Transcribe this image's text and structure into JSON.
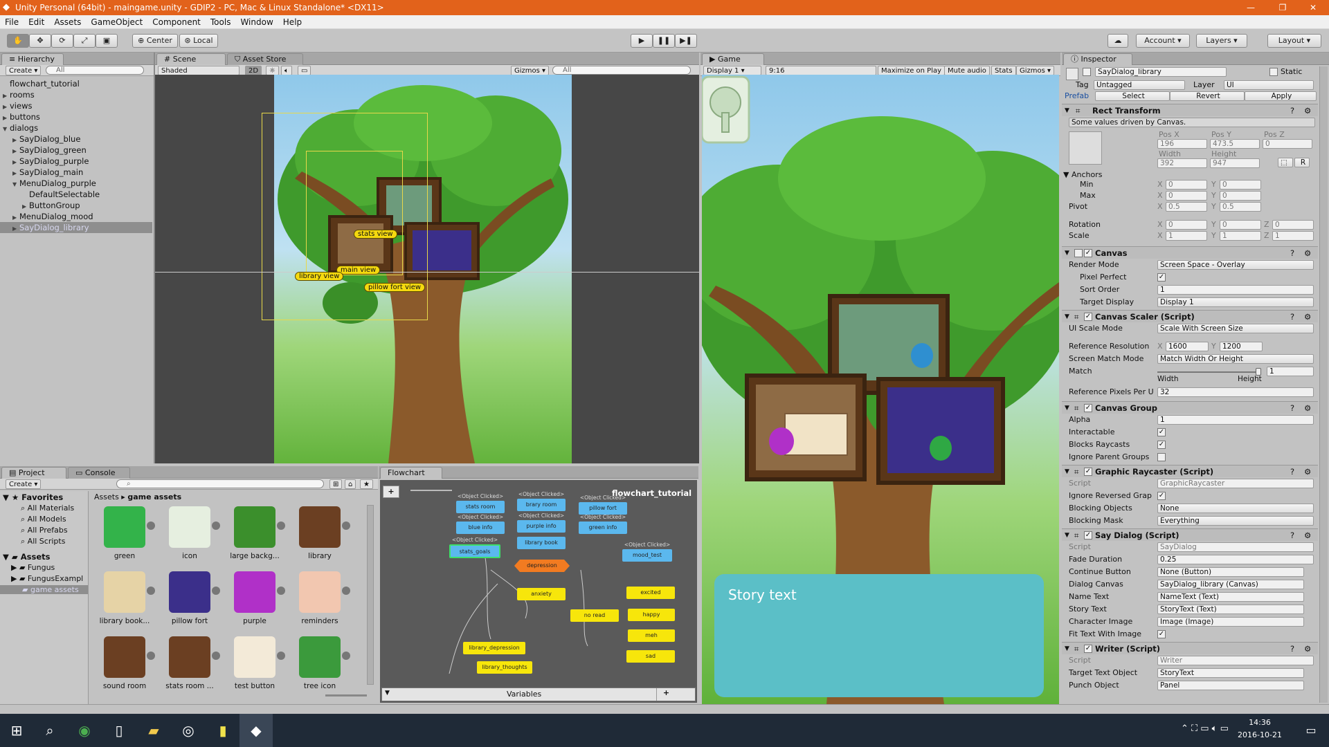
{
  "window": {
    "title": "Unity Personal (64bit) - maingame.unity - GDIP2 - PC, Mac & Linux Standalone* <DX11>",
    "min": "—",
    "max": "❐",
    "close": "✕"
  },
  "menu": [
    "File",
    "Edit",
    "Assets",
    "GameObject",
    "Component",
    "Tools",
    "Window",
    "Help"
  ],
  "toolbar": {
    "center": "Center",
    "local": "Local",
    "account": "Account",
    "layers": "Layers",
    "layout": "Layout"
  },
  "hierarchy": {
    "tab": "Hierarchy",
    "create": "Create",
    "search": "All",
    "items": [
      {
        "label": "flowchart_tutorial",
        "indent": 0,
        "arrow": ""
      },
      {
        "label": "rooms",
        "indent": 0,
        "arrow": "▶"
      },
      {
        "label": "views",
        "indent": 0,
        "arrow": "▶"
      },
      {
        "label": "buttons",
        "indent": 0,
        "arrow": "▶"
      },
      {
        "label": "dialogs",
        "indent": 0,
        "arrow": "▼"
      },
      {
        "label": "SayDialog_blue",
        "indent": 1,
        "arrow": "▶"
      },
      {
        "label": "SayDialog_green",
        "indent": 1,
        "arrow": "▶"
      },
      {
        "label": "SayDialog_purple",
        "indent": 1,
        "arrow": "▶"
      },
      {
        "label": "SayDialog_main",
        "indent": 1,
        "arrow": "▶"
      },
      {
        "label": "MenuDialog_purple",
        "indent": 1,
        "arrow": "▼"
      },
      {
        "label": "DefaultSelectable",
        "indent": 2,
        "arrow": ""
      },
      {
        "label": "ButtonGroup",
        "indent": 2,
        "arrow": "▶"
      },
      {
        "label": "MenuDialog_mood",
        "indent": 1,
        "arrow": "▶"
      },
      {
        "label": "SayDialog_library",
        "indent": 1,
        "arrow": "▶",
        "selected": true
      }
    ]
  },
  "scene": {
    "tab": "Scene",
    "store_tab": "Asset Store",
    "shading": "Shaded",
    "mode2d": "2D",
    "gizmos": "Gizmos",
    "search": "All",
    "labels": {
      "stats": "stats view",
      "main": "main view",
      "library": "library view",
      "pillow": "pillow fort view"
    }
  },
  "game": {
    "tab": "Game",
    "display": "Display 1",
    "aspect": "9:16",
    "maximize": "Maximize on Play",
    "mute": "Mute audio",
    "stats": "Stats",
    "gizmos": "Gizmos",
    "story_text": "Story text"
  },
  "project": {
    "tab": "Project",
    "console_tab": "Console",
    "create": "Create",
    "favorites": {
      "title": "Favorites",
      "items": [
        "All Materials",
        "All Models",
        "All Prefabs",
        "All Scripts"
      ]
    },
    "assets": {
      "title": "Assets",
      "items": [
        "Fungus",
        "FungusExampl",
        "game assets"
      ]
    },
    "breadcrumb": [
      "Assets",
      "game assets"
    ],
    "grid": [
      "green",
      "icon",
      "large backg...",
      "library",
      "library book...",
      "pillow fort",
      "purple",
      "reminders",
      "sound room",
      "stats room ...",
      "test button",
      "tree icon"
    ]
  },
  "flowchart": {
    "tab": "Flowchart",
    "name": "flowchart_tutorial",
    "variables": "Variables",
    "add": "+",
    "caption": "<Object Clicked>",
    "blue_nodes": [
      "stats room",
      "brary room",
      "pillow fort",
      "blue info",
      "purple info",
      "green info",
      "library book",
      "mood_test"
    ],
    "green_node": "stats_goals",
    "orange_node": "depression",
    "yellow_nodes": [
      "anxiety",
      "no read",
      "excited",
      "happy",
      "meh",
      "sad",
      "library_depression",
      "library_thoughts"
    ]
  },
  "inspector": {
    "tab": "Inspector",
    "name": "SayDialog_library",
    "static": "Static",
    "tag_label": "Tag",
    "tag": "Untagged",
    "layer_label": "Layer",
    "layer": "UI",
    "prefab": "Prefab",
    "select": "Select",
    "revert": "Revert",
    "apply": "Apply",
    "rect": {
      "title": "Rect Transform",
      "note": "Some values driven by Canvas.",
      "posx_l": "Pos X",
      "posy_l": "Pos Y",
      "posz_l": "Pos Z",
      "posx": "196",
      "posy": "473.5",
      "posz": "0",
      "width_l": "Width",
      "height_l": "Height",
      "width": "392",
      "height": "947",
      "anchors": "Anchors",
      "min": "Min",
      "max": "Max",
      "pivot": "Pivot",
      "rotation": "Rotation",
      "scale": "Scale",
      "min_x": "0",
      "min_y": "0",
      "max_x": "0",
      "max_y": "0",
      "pivot_x": "0.5",
      "pivot_y": "0.5",
      "rot_x": "0",
      "rot_y": "0",
      "rot_z": "0",
      "sc_x": "1",
      "sc_y": "1",
      "sc_z": "1"
    },
    "canvas": {
      "title": "Canvas",
      "render_mode_l": "Render Mode",
      "render_mode": "Screen Space - Overlay",
      "pixel_perfect": "Pixel Perfect",
      "sort_order_l": "Sort Order",
      "sort_order": "1",
      "target_display_l": "Target Display",
      "target_display": "Display 1"
    },
    "scaler": {
      "title": "Canvas Scaler (Script)",
      "ui_scale_l": "UI Scale Mode",
      "ui_scale": "Scale With Screen Size",
      "ref_res_l": "Reference Resolution",
      "ref_x": "1600",
      "ref_y": "1200",
      "match_mode_l": "Screen Match Mode",
      "match_mode": "Match Width Or Height",
      "match_l": "Match",
      "match": "1",
      "width": "Width",
      "height": "Height",
      "ppu_l": "Reference Pixels Per U",
      "ppu": "32"
    },
    "group": {
      "title": "Canvas Group",
      "alpha_l": "Alpha",
      "alpha": "1",
      "interactable": "Interactable",
      "blocks": "Blocks Raycasts",
      "ignore": "Ignore Parent Groups"
    },
    "raycaster": {
      "title": "Graphic Raycaster (Script)",
      "script_l": "Script",
      "script": "GraphicRaycaster",
      "ignore_rev": "Ignore Reversed Grap",
      "blocking_l": "Blocking Objects",
      "blocking": "None",
      "mask_l": "Blocking Mask",
      "mask": "Everything"
    },
    "say": {
      "title": "Say Dialog (Script)",
      "script_l": "Script",
      "script": "SayDialog",
      "fade_l": "Fade Duration",
      "fade": "0.25",
      "cont_l": "Continue Button",
      "cont": "None (Button)",
      "canvas_l": "Dialog Canvas",
      "canvas": "SayDialog_library (Canvas)",
      "name_l": "Name Text",
      "name": "NameText (Text)",
      "story_l": "Story Text",
      "story": "StoryText (Text)",
      "char_l": "Character Image",
      "char": "Image (Image)",
      "fit_l": "Fit Text With Image"
    },
    "writer": {
      "title": "Writer (Script)",
      "script_l": "Script",
      "script": "Writer",
      "target_l": "Target Text Object",
      "target": "StoryText",
      "punch_l": "Punch Object",
      "punch": "Panel"
    }
  },
  "taskbar": {
    "time": "14:36",
    "date": "2016-10-21"
  },
  "colors": {
    "titlebar": "#e2621b",
    "panel": "#c2c2c2",
    "scene_bg": "#474747",
    "flow_bg": "#5a5a5a",
    "node_blue": "#5bb8ee",
    "node_yellow": "#f7e60b",
    "node_orange": "#f27b21",
    "dialog_teal": "#5bbfc7"
  }
}
